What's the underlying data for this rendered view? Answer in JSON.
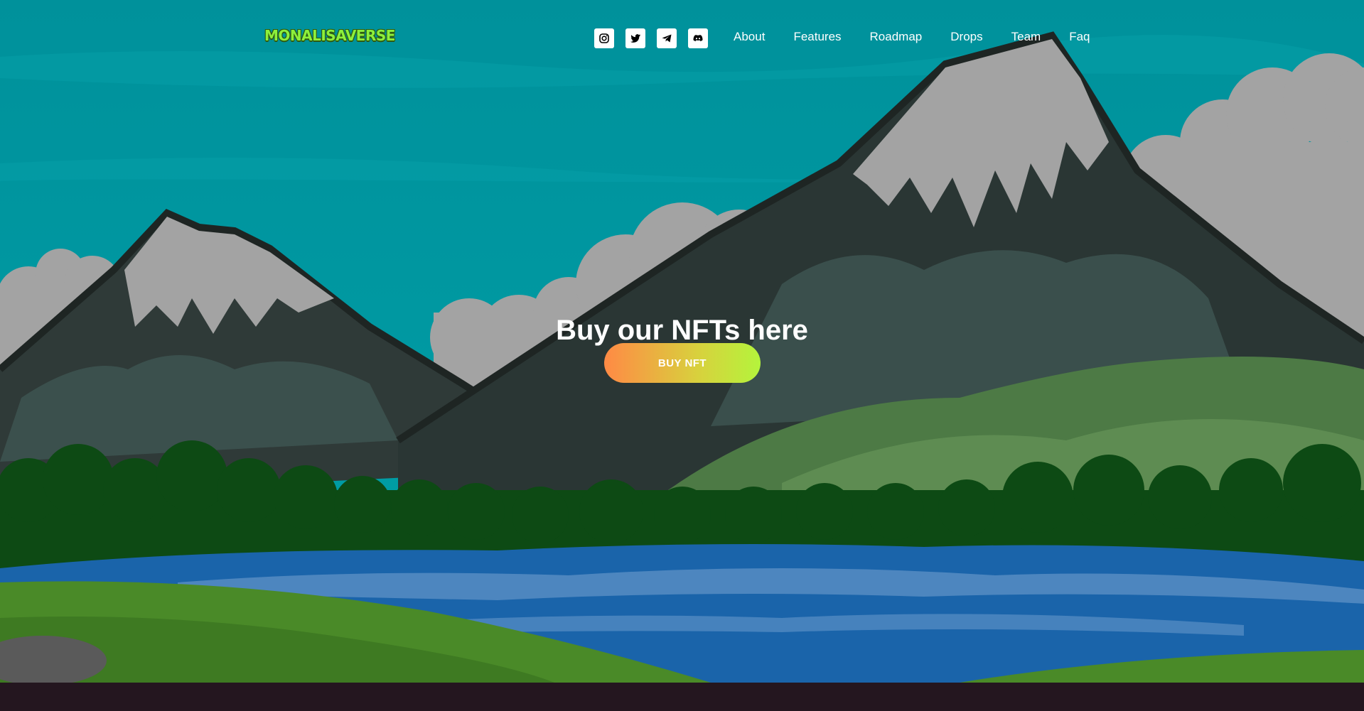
{
  "brand": {
    "logo_text": "MONALISAVERSE"
  },
  "socials": [
    {
      "name": "instagram-icon"
    },
    {
      "name": "twitter-icon"
    },
    {
      "name": "telegram-icon"
    },
    {
      "name": "discord-icon"
    }
  ],
  "nav": {
    "items": [
      {
        "label": "About"
      },
      {
        "label": "Features"
      },
      {
        "label": "Roadmap"
      },
      {
        "label": "Drops"
      },
      {
        "label": "Team"
      },
      {
        "label": "Faq"
      }
    ]
  },
  "hero": {
    "headline": "Buy our NFTs here",
    "cta_label": "BUY NFT"
  },
  "colors": {
    "sky": "#008f99",
    "logo": "#8cf03c",
    "cta_start": "#ff8a45",
    "cta_end": "#b4f43c",
    "footer": "#24161f"
  }
}
